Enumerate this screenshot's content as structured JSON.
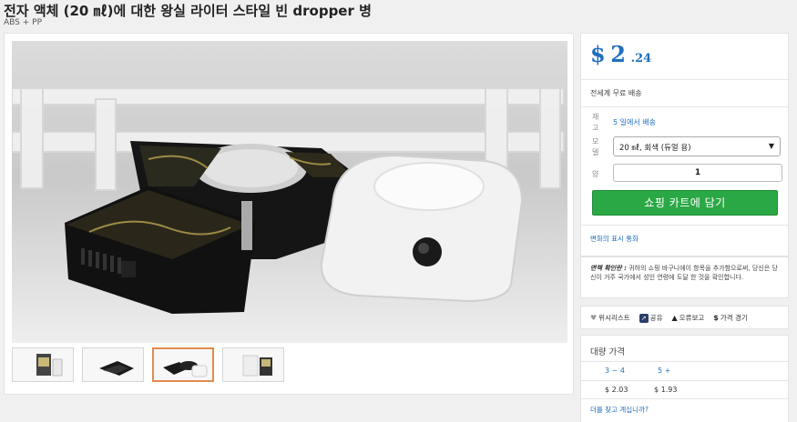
{
  "product": {
    "title": "전자 액체 (20 ㎖)에 대한 왕실 라이터 스타일 빈 dropper 병",
    "material": "ABS + PP"
  },
  "gallery": {
    "thumbnails": [
      "thumb-1",
      "thumb-2",
      "thumb-3",
      "thumb-4"
    ],
    "active_index": 2
  },
  "price": {
    "currency_symbol": "$",
    "whole": "2",
    "cents": ".24"
  },
  "shipping": "전세계 무료 배송",
  "stock": {
    "label": "재고",
    "value": "5 일에서 배송"
  },
  "model": {
    "label": "모델",
    "selected": "20 ㎖, 회색 (듀얼 용)"
  },
  "quantity": {
    "label": "양",
    "value": "1"
  },
  "cart_button": "쇼핑 카트에 담기",
  "currency_link": "변화의 표시 통화",
  "notice": {
    "heading": "면책 확인란 :",
    "body": "귀하의 쇼핑 바구니에이 항목을 추가함으로써, 당신은 당신이 거주 국가에서 성인 연령에 도달 한 것을 확인합니다."
  },
  "actions": {
    "wishlist": "위시리스트",
    "share": "공유",
    "report": "오류보고",
    "price_alert": "가격 경기"
  },
  "bulk": {
    "title": "대량 가격",
    "tiers": [
      {
        "qty": "3 ~ 4",
        "price": "$ 2.03"
      },
      {
        "qty": "5 +",
        "price": "$ 1.93"
      }
    ],
    "more_link": "더를 찾고 계십니까?"
  },
  "colors": {
    "accent": "#1f6fbf",
    "cart": "#2aa845",
    "thumb_active": "#e28b4b"
  }
}
